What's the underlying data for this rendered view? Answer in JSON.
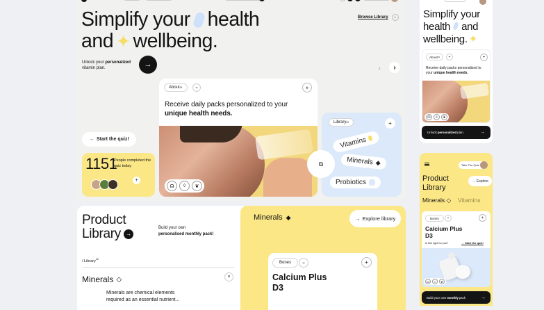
{
  "hero": {
    "title_line1": "Simplify your",
    "title_word": "health",
    "title_line2a": "and",
    "title_line2b": "wellbeing.",
    "sub_part1": "Unlock your ",
    "sub_bold": "personalized",
    "sub_part2": "vitamin plan.",
    "browse_library": "Browse Library",
    "start_quiz": "Start the quiz!",
    "count": "1151",
    "count_caption": "People completed the quiz today"
  },
  "about_card": {
    "badge": "About",
    "badge_sup": "01",
    "text_part1": "Receive daily packs personalized to your ",
    "text_bold": "unique health needs."
  },
  "library_card": {
    "badge": "Library",
    "badge_sup": "02",
    "tags": [
      "Vitamins",
      "Minerals",
      "Probiotics"
    ]
  },
  "product_library": {
    "title_line1": "Product",
    "title_line2": "Library",
    "side_line1": "Build your own",
    "side_bold": "personalised monthly pack!",
    "breadcrumb": "/ Library",
    "breadcrumb_sup": "02",
    "section_title": "Minerals",
    "description_line1": "Minerals are chemical elements",
    "description_line2": "required as an essential nutrient..."
  },
  "minerals_panel": {
    "title": "Minerals",
    "explore_button": "Explore library",
    "product_tag": "Bones",
    "product_name_line1": "Calcium Plus",
    "product_name_line2": "D3"
  },
  "mobile_top": {
    "title_line1": "Simplify your",
    "title_line2a": "health",
    "title_line2b": "and",
    "title_line3": "wellbeing.",
    "badge": "About",
    "badge_sup": "01",
    "text_part1": "Receive daily packs personalized to your ",
    "text_bold": "unique health needs.",
    "cta_part1": "Unlock ",
    "cta_bold": "personalized",
    "cta_part2": " plan."
  },
  "mobile_bottom": {
    "take_quiz": "Take The Quiz",
    "title_line1": "Product",
    "title_line2": "Library",
    "explore": "Explore",
    "tab_active": "Minerals",
    "tab_inactive": "Vitamins",
    "product_tag": "Bones",
    "product_name_line1": "Calcium Plus",
    "product_name_line2": "D3",
    "question": "Is this right for you?",
    "start_quiz": "Start the quiz!",
    "cta_part1": "Build your own ",
    "cta_bold": "monthly",
    "cta_part2": " pack"
  },
  "colors": {
    "yellow": "#fbe786",
    "blue": "#dbe9fb",
    "dark": "#141414"
  }
}
